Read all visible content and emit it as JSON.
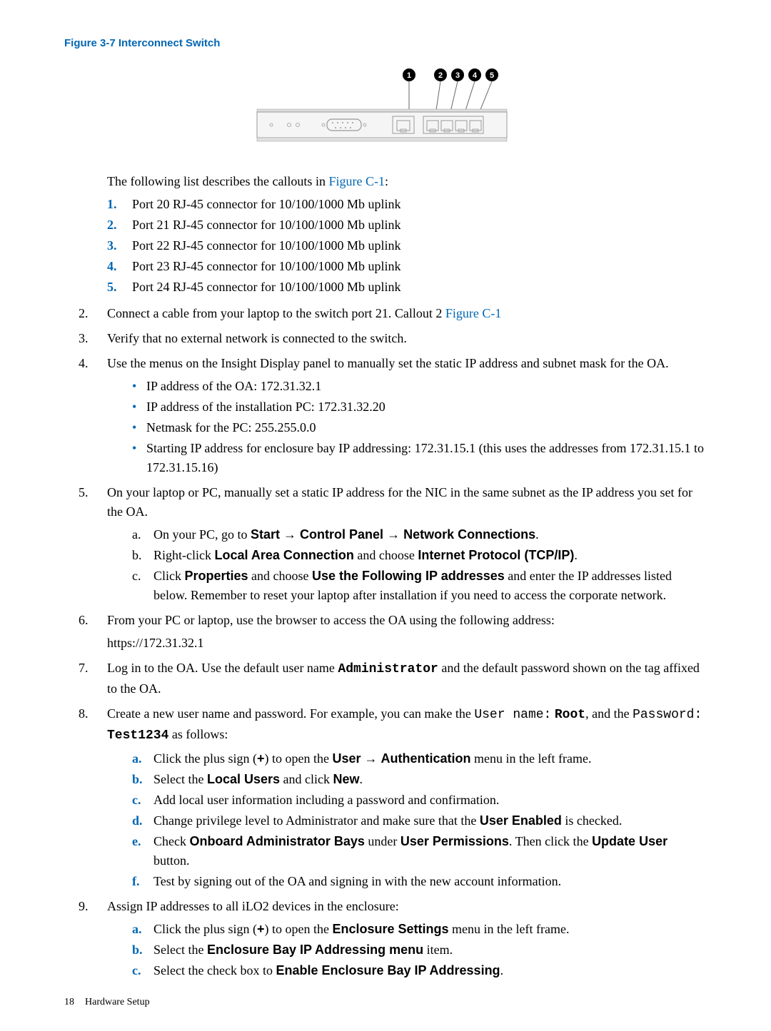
{
  "figure": {
    "title": "Figure 3-7 Interconnect Switch"
  },
  "callouts_intro": "The following list describes the callouts in ",
  "callouts_link": "Figure C-1",
  "callout_items": [
    "Port 20 RJ-45 connector for 10/100/1000 Mb uplink",
    "Port 21 RJ-45 connector for 10/100/1000 Mb uplink",
    "Port 22 RJ-45 connector for 10/100/1000 Mb uplink",
    "Port 23 RJ-45 connector for 10/100/1000 Mb uplink",
    "Port 24 RJ-45 connector for 10/100/1000 Mb uplink"
  ],
  "step2": {
    "text": "Connect a cable from your laptop to the switch port 21. Callout 2 ",
    "link": "Figure C-1"
  },
  "step3": "Verify that no external network is connected to the switch.",
  "step4": {
    "text": "Use the menus on the Insight Display panel to manually set the static IP address and subnet mask for the OA.",
    "bullets": [
      "IP address of the OA: 172.31.32.1",
      "IP address of the installation PC: 172.31.32.20",
      "Netmask for the PC: 255.255.0.0",
      "Starting IP address for enclosure bay IP addressing: 172.31.15.1 (this uses the addresses from 172.31.15.1 to 172.31.15.16)"
    ]
  },
  "step5": {
    "text": "On your laptop or PC, manually set a static IP address for the NIC in the same subnet as the IP address you set for the OA.",
    "a_pre": "On your PC, go to ",
    "a_bold1": "Start",
    "a_arrow1": " → ",
    "a_bold2": "Control Panel",
    "a_arrow2": " → ",
    "a_bold3": "Network Connections",
    "a_post": ".",
    "b_pre": "Right-click ",
    "b_bold1": "Local Area Connection",
    "b_mid": " and choose ",
    "b_bold2": "Internet Protocol (TCP/IP)",
    "b_post": ".",
    "c_pre": "Click ",
    "c_bold1": "Properties",
    "c_mid": " and choose ",
    "c_bold2": "Use the Following IP addresses",
    "c_post": " and enter the IP addresses listed below. Remember to reset your laptop after installation if you need to access the corporate network."
  },
  "step6": {
    "line1": "From your PC or laptop, use the browser to access the OA using the following address:",
    "line2": "https://172.31.32.1"
  },
  "step7": {
    "pre": "Log in to the OA. Use the default user name ",
    "mono1": "Administrator",
    "post": " and the default password shown on the tag affixed to the OA."
  },
  "step8": {
    "pre": "Create a new user name and password. For example, you can make the ",
    "mono1": "User name:",
    "bold1": "Root",
    "mid1": ", and the ",
    "mono2": "Password:",
    "bold2": "Test1234",
    "post": " as follows:",
    "a_pre": "Click the plus sign (",
    "a_plus": "+",
    "a_mid": ") to open the ",
    "a_bold1": "User",
    "a_arrow": " → ",
    "a_bold2": "Authentication",
    "a_post": " menu in the left frame.",
    "b_pre": "Select the ",
    "b_bold1": "Local Users",
    "b_mid": " and click ",
    "b_bold2": "New",
    "b_post": ".",
    "c": "Add local user information including a password and confirmation.",
    "d_pre": "Change privilege level to Administrator and make sure that the ",
    "d_bold": "User Enabled",
    "d_post": " is checked.",
    "e_pre": "Check ",
    "e_bold1": "Onboard Administrator Bays",
    "e_mid1": " under ",
    "e_bold2": "User Permissions",
    "e_mid2": ". Then click the ",
    "e_bold3": "Update User",
    "e_post": " button.",
    "f": "Test by signing out of the OA and signing in with the new account information."
  },
  "step9": {
    "text": "Assign IP addresses to all iLO2 devices in the enclosure:",
    "a_pre": "Click the plus sign (",
    "a_plus": "+",
    "a_mid": ") to open the ",
    "a_bold": "Enclosure Settings",
    "a_post": " menu in the left frame.",
    "b_pre": "Select the ",
    "b_bold": "Enclosure Bay IP Addressing menu",
    "b_post": " item.",
    "c_pre": "Select the check box to ",
    "c_bold": "Enable Enclosure Bay IP Addressing",
    "c_post": "."
  },
  "footer": {
    "page": "18",
    "title": "Hardware Setup"
  }
}
